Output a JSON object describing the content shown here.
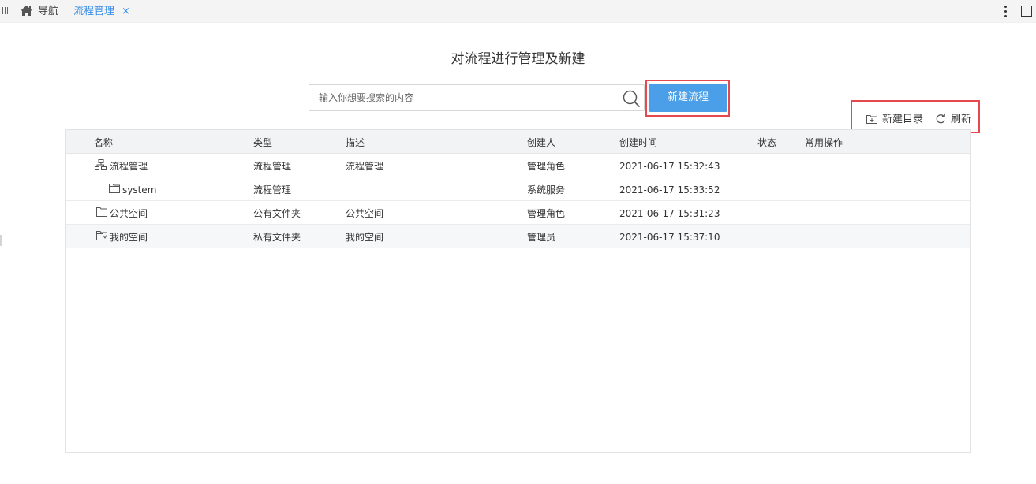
{
  "tabbar": {
    "nav_label": "导航",
    "active_tab": "流程管理",
    "close_glyph": "×"
  },
  "page": {
    "title": "对流程进行管理及新建"
  },
  "search": {
    "placeholder": "输入你想要搜索的内容",
    "value": ""
  },
  "actions": {
    "new_flow": "新建流程",
    "new_folder": "新建目录",
    "refresh": "刷新"
  },
  "colors": {
    "accent": "#4a9fe8",
    "active_tab": "#3a8ee6",
    "highlight": "#e5484d"
  },
  "table": {
    "columns": [
      "名称",
      "类型",
      "描述",
      "创建人",
      "创建时间",
      "状态",
      "常用操作"
    ],
    "rows": [
      {
        "icon": "flow-tree-icon",
        "name": "流程管理",
        "type": "流程管理",
        "desc": "流程管理",
        "creator": "管理角色",
        "created": "2021-06-17 15:32:43",
        "status": "",
        "ops": ""
      },
      {
        "icon": "folder-icon",
        "name": "system",
        "type": "流程管理",
        "desc": "",
        "creator": "系统服务",
        "created": "2021-06-17 15:33:52",
        "status": "",
        "ops": ""
      },
      {
        "icon": "folder-icon",
        "name": "公共空间",
        "type": "公有文件夹",
        "desc": "公共空间",
        "creator": "管理角色",
        "created": "2021-06-17 15:31:23",
        "status": "",
        "ops": ""
      },
      {
        "icon": "private-folder-icon",
        "name": "我的空间",
        "type": "私有文件夹",
        "desc": "我的空间",
        "creator": "管理员",
        "created": "2021-06-17 15:37:10",
        "status": "",
        "ops": ""
      }
    ]
  }
}
